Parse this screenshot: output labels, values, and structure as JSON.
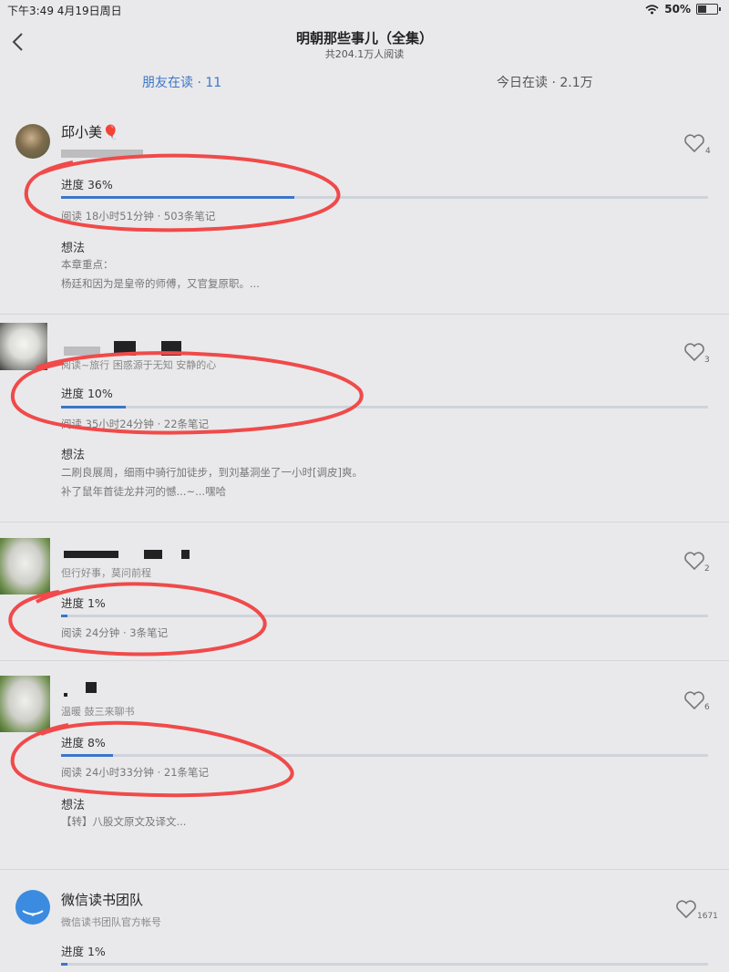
{
  "status_bar": {
    "time": "下午3:49  4月19日周日",
    "battery": "50%",
    "battery_level": 0.5
  },
  "header": {
    "title": "明朝那些事儿（全集）",
    "subtitle": "共204.1万人阅读"
  },
  "tabs": [
    {
      "label": "朋友在读 · 11",
      "active": true
    },
    {
      "label": "今日在读 · 2.1万",
      "active": false
    }
  ],
  "colors": {
    "accent": "#3b76c8",
    "annotation": "#f04a4a",
    "background": "#e9e9eb"
  },
  "entries": [
    {
      "name": "邱小美🎈",
      "bio": "",
      "likes": "4",
      "progress_label": "进度 36%",
      "progress": 0.36,
      "stats": "阅读 18小时51分钟 · 503条笔记",
      "thought_heading": "想法",
      "thought_lines": [
        "本章重点：",
        "杨廷和因为是皇帝的师傅，又官复原职。..."
      ]
    },
    {
      "name": "",
      "bio": "阅读~旅行 困惑源于无知 安静的心",
      "likes": "3",
      "progress_label": "进度 10%",
      "progress": 0.1,
      "stats": "阅读 35小时24分钟 · 22条笔记",
      "thought_heading": "想法",
      "thought_lines": [
        "二刷良展周，细雨中骑行加徒步，到刘基洞坐了一小时[调皮]爽。",
        "补了鼠年首徒龙井河的憾...~...嘿哈"
      ]
    },
    {
      "name": "",
      "bio": "但行好事，莫问前程",
      "likes": "2",
      "progress_label": "进度 1%",
      "progress": 0.01,
      "stats": "阅读 24分钟 · 3条笔记"
    },
    {
      "name": "",
      "bio": "温暖 鼓三来聊书",
      "likes": "6",
      "progress_label": "进度 8%",
      "progress": 0.08,
      "stats": "阅读 24小时33分钟 · 21条笔记",
      "thought_heading": "想法",
      "thought_lines": [
        "【转】八股文原文及译文..."
      ]
    },
    {
      "name": "微信读书团队",
      "bio": "微信读书团队官方帐号",
      "likes": "1671",
      "progress_label": "进度 1%",
      "progress": 0.01
    }
  ]
}
